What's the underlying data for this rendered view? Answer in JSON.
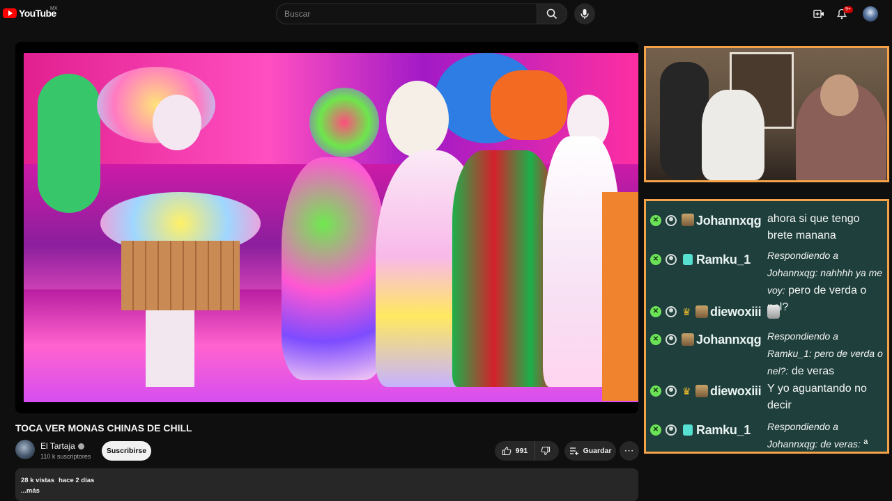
{
  "header": {
    "logo_text": "YouTube",
    "country_code": "MX",
    "search_placeholder": "Buscar",
    "notification_count": "9+"
  },
  "video": {
    "title": "TOCA VER MONAS CHINAS DE CHILL"
  },
  "channel": {
    "name": "El Tartaja",
    "subscribers": "110 k suscriptores",
    "subscribe_label": "Suscribirse"
  },
  "actions": {
    "likes": "991",
    "save_label": "Guardar"
  },
  "description": {
    "views": "28 k vistas",
    "date": "hace 2 días",
    "more": "...más"
  },
  "chat": [
    {
      "user": "Johannxqg",
      "badge": "sub-tile",
      "text": "ahora si que tengo brete manana",
      "reply": ""
    },
    {
      "user": "Ramku_1",
      "badge": "gift",
      "reply": "Respondiendo a Johannxqg: nahhhh ya me voy:",
      "text": "pero de verda o nel?"
    },
    {
      "user": "diewoxiii",
      "badge": "crown",
      "text": "",
      "reply": ""
    },
    {
      "user": "Johannxqg",
      "badge": "sub-tile",
      "reply": "Respondiendo a Ramku_1: pero de verda o nel?:",
      "text": "de veras"
    },
    {
      "user": "diewoxiii",
      "badge": "crown",
      "text": "Y yo aguantando no decir",
      "reply": ""
    },
    {
      "user": "Ramku_1",
      "badge": "gift",
      "reply": "Respondiendo a Johannxqg: de veras:",
      "text": "ª"
    }
  ],
  "colors": {
    "accent_red": "#ff0000",
    "chat_border": "#f5a249",
    "chat_bg": "#1f3f3c",
    "mod_badge": "#6be357"
  }
}
